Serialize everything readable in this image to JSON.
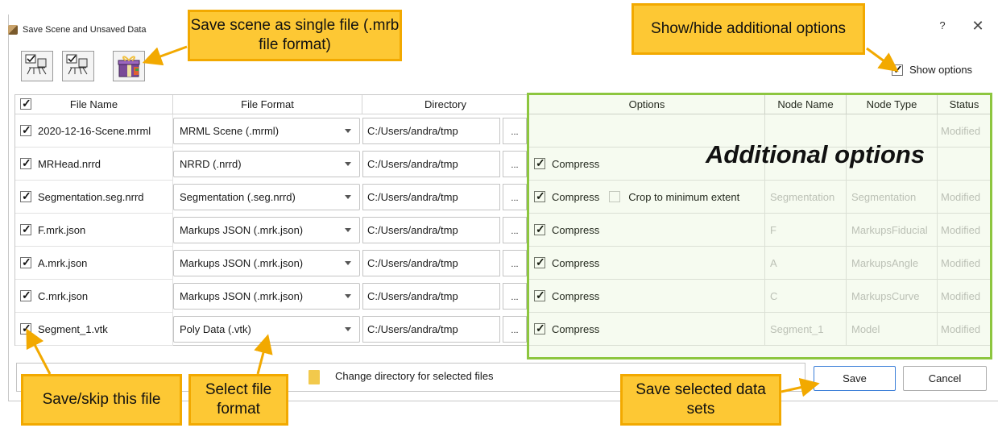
{
  "window": {
    "title": "Save Scene and Unsaved Data",
    "help": "?",
    "close": "✕"
  },
  "options_toggle": {
    "label": "Show options",
    "checked": true
  },
  "table": {
    "headers": [
      "File Name",
      "File Format",
      "Directory",
      "Options",
      "Node Name",
      "Node Type",
      "Status"
    ],
    "rows": [
      {
        "file": "2020-12-16-Scene.mrml",
        "format": "MRML Scene (.mrml)",
        "dir": "C:/Users/andra/tmp",
        "more": "...",
        "compress": "",
        "crop": "",
        "node_name": "",
        "node_type": "",
        "status": "Modified"
      },
      {
        "file": "MRHead.nrrd",
        "format": "NRRD (.nrrd)",
        "dir": "C:/Users/andra/tmp",
        "more": "...",
        "compress": "Compress",
        "crop": "",
        "node_name": "",
        "node_type": "",
        "status": ""
      },
      {
        "file": "Segmentation.seg.nrrd",
        "format": "Segmentation (.seg.nrrd)",
        "dir": "C:/Users/andra/tmp",
        "more": "...",
        "compress": "Compress",
        "crop": "Crop to minimum extent",
        "node_name": "Segmentation",
        "node_type": "Segmentation",
        "status": "Modified"
      },
      {
        "file": "F.mrk.json",
        "format": "Markups JSON (.mrk.json)",
        "dir": "C:/Users/andra/tmp",
        "more": "...",
        "compress": "Compress",
        "crop": "",
        "node_name": "F",
        "node_type": "MarkupsFiducial",
        "status": "Modified"
      },
      {
        "file": "A.mrk.json",
        "format": "Markups JSON (.mrk.json)",
        "dir": "C:/Users/andra/tmp",
        "more": "...",
        "compress": "Compress",
        "crop": "",
        "node_name": "A",
        "node_type": "MarkupsAngle",
        "status": "Modified"
      },
      {
        "file": "C.mrk.json",
        "format": "Markups JSON (.mrk.json)",
        "dir": "C:/Users/andra/tmp",
        "more": "...",
        "compress": "Compress",
        "crop": "",
        "node_name": "C",
        "node_type": "MarkupsCurve",
        "status": "Modified"
      },
      {
        "file": "Segment_1.vtk",
        "format": "Poly Data (.vtk)",
        "dir": "C:/Users/andra/tmp",
        "more": "...",
        "compress": "Compress",
        "crop": "",
        "node_name": "Segment_1",
        "node_type": "Model",
        "status": "Modified"
      }
    ]
  },
  "bottom": {
    "change_dir": "Change directory for selected files",
    "save": "Save",
    "cancel": "Cancel"
  },
  "annotations": {
    "single_file": "Save scene as single file (.mrb file format)",
    "show_hide": "Show/hide additional options",
    "additional": "Additional options",
    "save_skip": "Save/skip this file",
    "select_format": "Select file format",
    "save_selected": "Save selected data sets"
  },
  "colors": {
    "callout_fill": "#fdc834",
    "callout_border": "#f2a900",
    "options_region": "#8dc63f"
  }
}
